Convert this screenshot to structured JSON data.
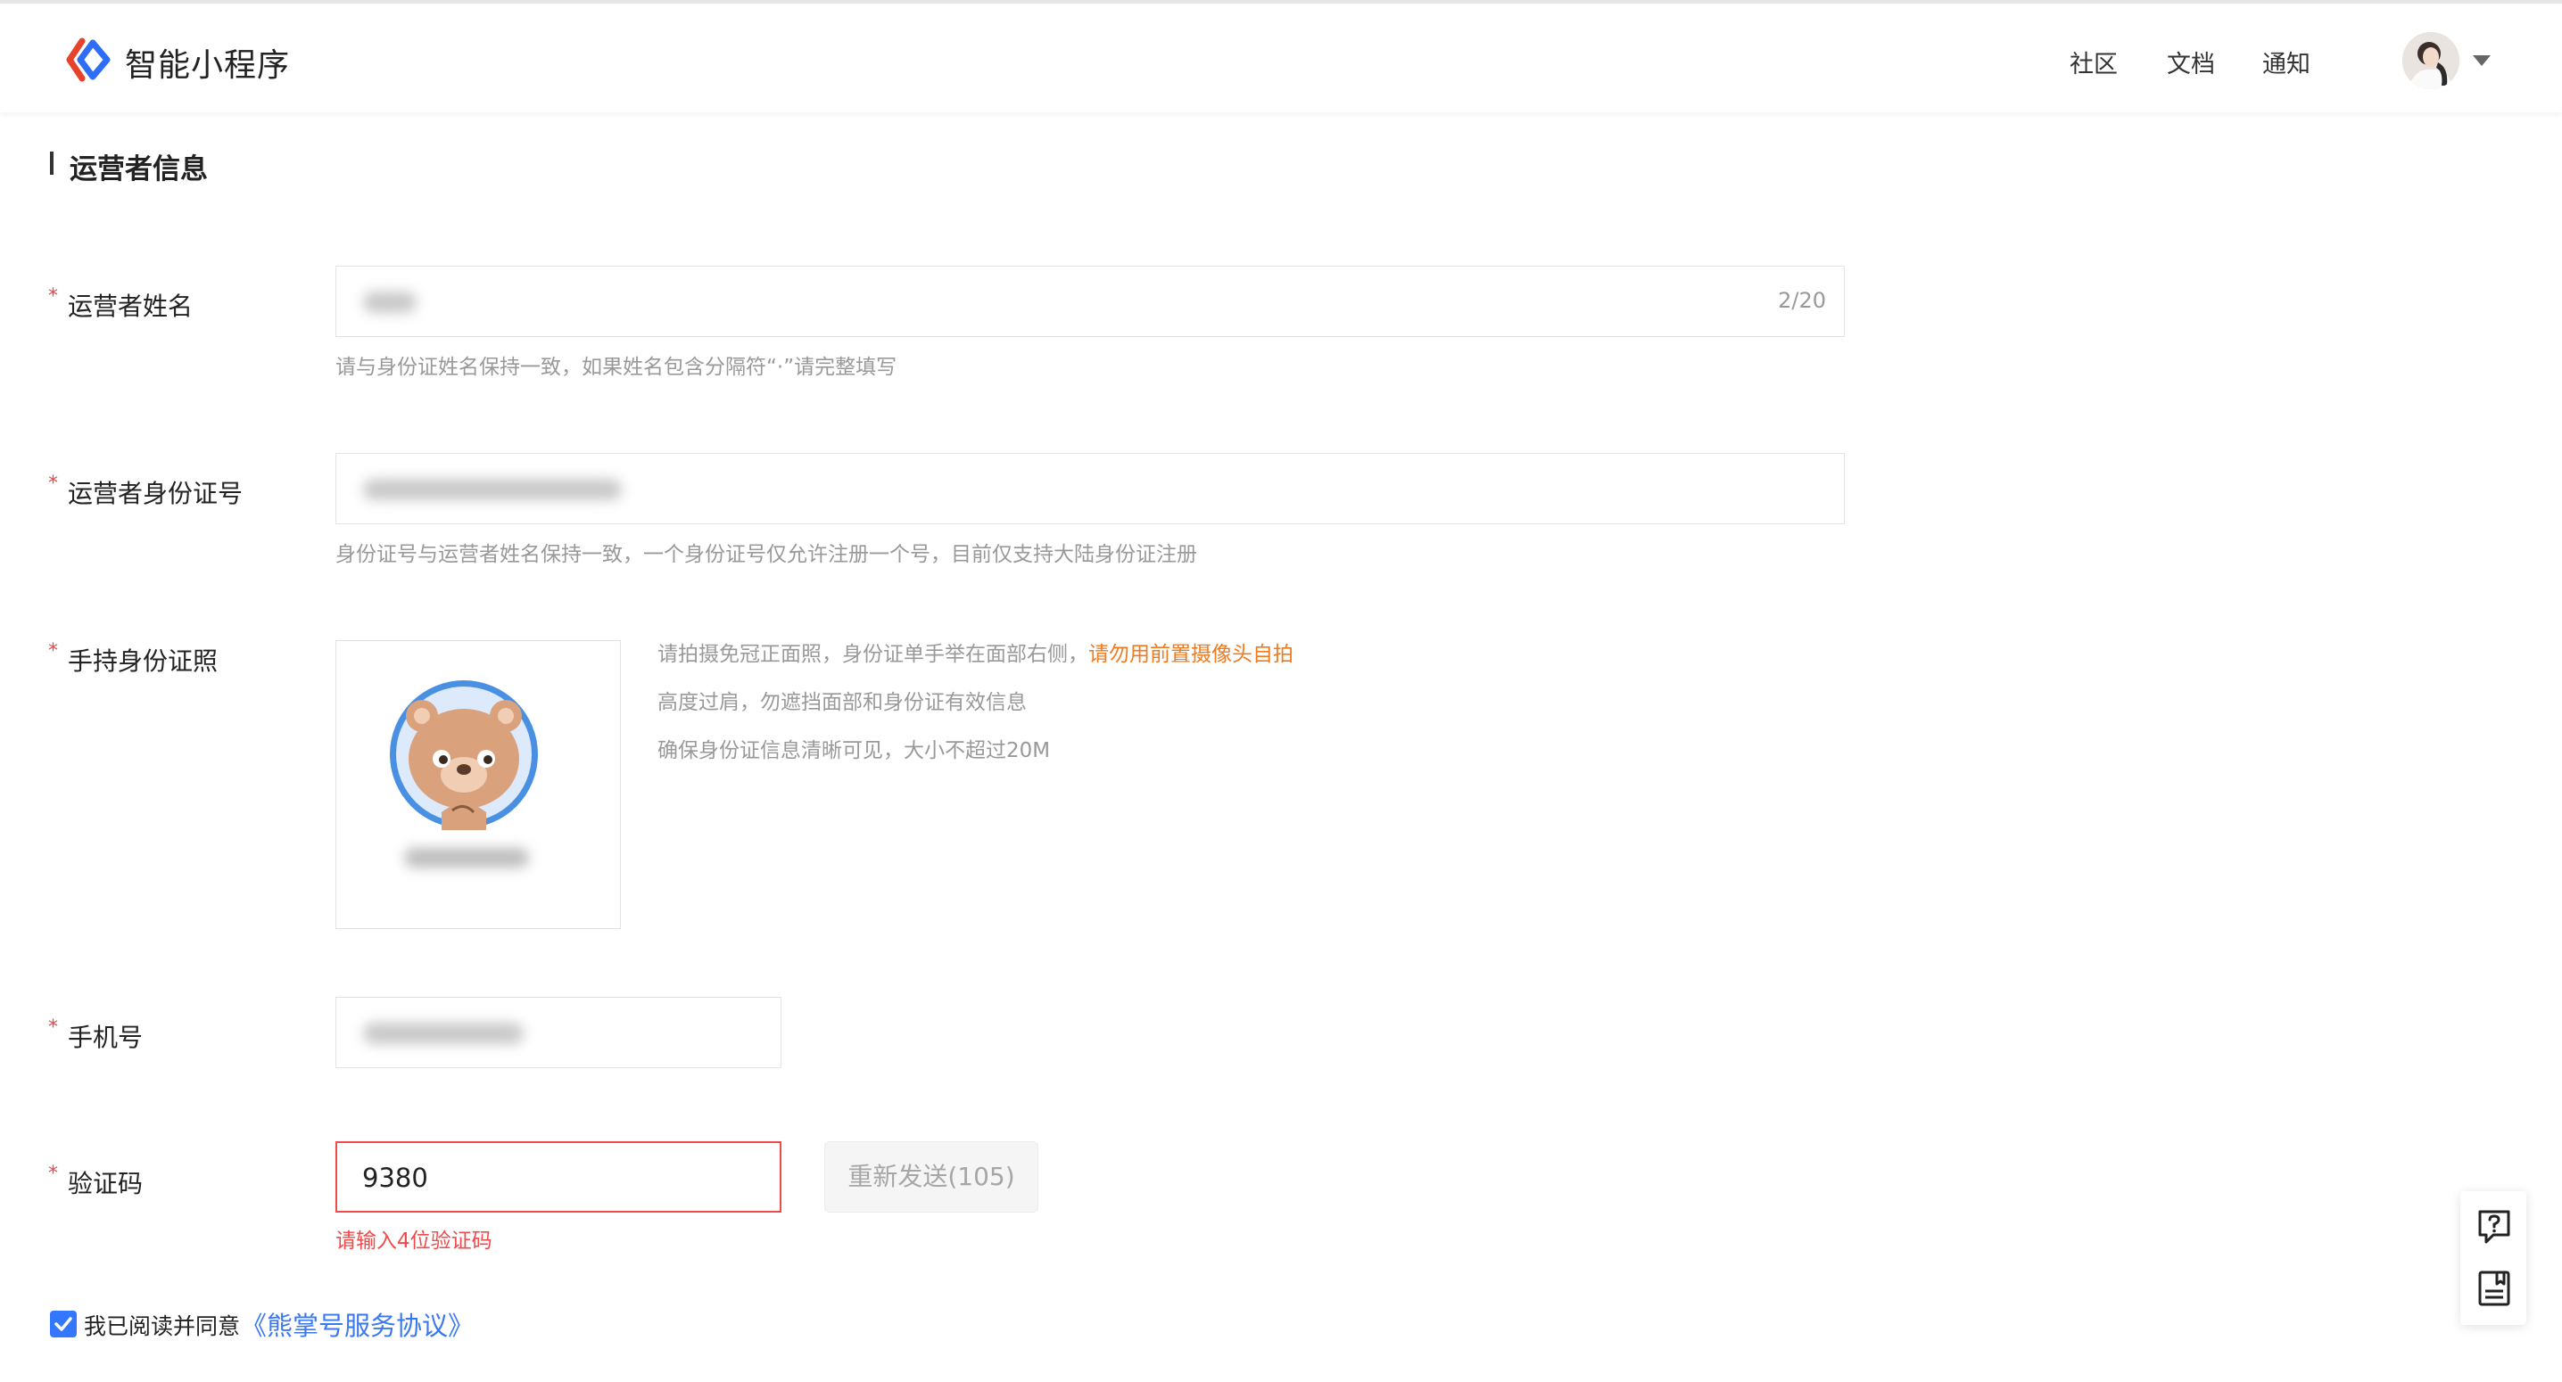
{
  "header": {
    "brand": "智能小程序",
    "nav": {
      "community": "社区",
      "docs": "文档",
      "notice": "通知"
    },
    "logo_icon": "swan-logo-icon",
    "colors": {
      "logo_red": "#e8412c",
      "logo_blue": "#2e6df6"
    }
  },
  "section": {
    "title": "运营者信息"
  },
  "form": {
    "name": {
      "label": "运营者姓名",
      "counter": "2/20",
      "hint": "请与身份证姓名保持一致，如果姓名包含分隔符“·”请完整填写"
    },
    "id_number": {
      "label": "运营者身份证号",
      "hint": "身份证号与运营者姓名保持一致，一个身份证号仅允许注册一个号，目前仅支持大陆身份证注册"
    },
    "id_photo": {
      "label": "手持身份证照",
      "hint_line1": "请拍摄免冠正面照，身份证单手举在面部右侧，",
      "hint_line1_warn": "请勿用前置摄像头自拍",
      "hint_line2": "高度过肩，勿遮挡面部和身份证有效信息",
      "hint_line3": "确保身份证信息清晰可见，大小不超过20M",
      "avatar_icon": "bear-avatar-icon"
    },
    "phone": {
      "label": "手机号"
    },
    "verify_code": {
      "label": "验证码",
      "value": "9380",
      "resend_label": "重新发送(105)",
      "error": "请输入4位验证码"
    }
  },
  "agreement": {
    "checked": true,
    "text": "我已阅读并同意",
    "link": "《熊掌号服务协议》"
  },
  "float_tools": {
    "help_icon": "help-chat-icon",
    "notes_icon": "document-icon"
  }
}
